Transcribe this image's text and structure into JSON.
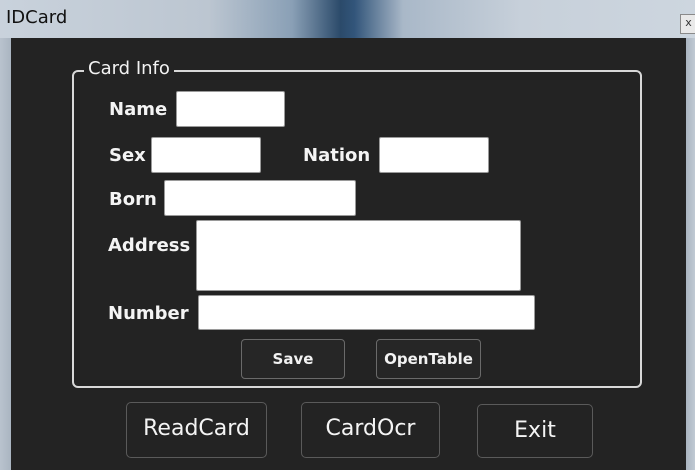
{
  "window": {
    "title": "IDCard",
    "close_glyph": "x"
  },
  "card_info": {
    "group_title": "Card Info",
    "name_label": "Name",
    "name_value": "",
    "sex_label": "Sex",
    "sex_value": "",
    "nation_label": "Nation",
    "nation_value": "",
    "born_label": "Born",
    "born_value": "",
    "address_label": "Address",
    "address_value": "",
    "number_label": "Number",
    "number_value": "",
    "save_label": "Save",
    "open_table_label": "OpenTable"
  },
  "actions": {
    "read_card_label": "ReadCard",
    "card_ocr_label": "CardOcr",
    "exit_label": "Exit"
  },
  "icons": {
    "close": "close-icon"
  },
  "colors": {
    "background": "#232323",
    "text": "#f4f4f4",
    "field": "#ffffff"
  }
}
